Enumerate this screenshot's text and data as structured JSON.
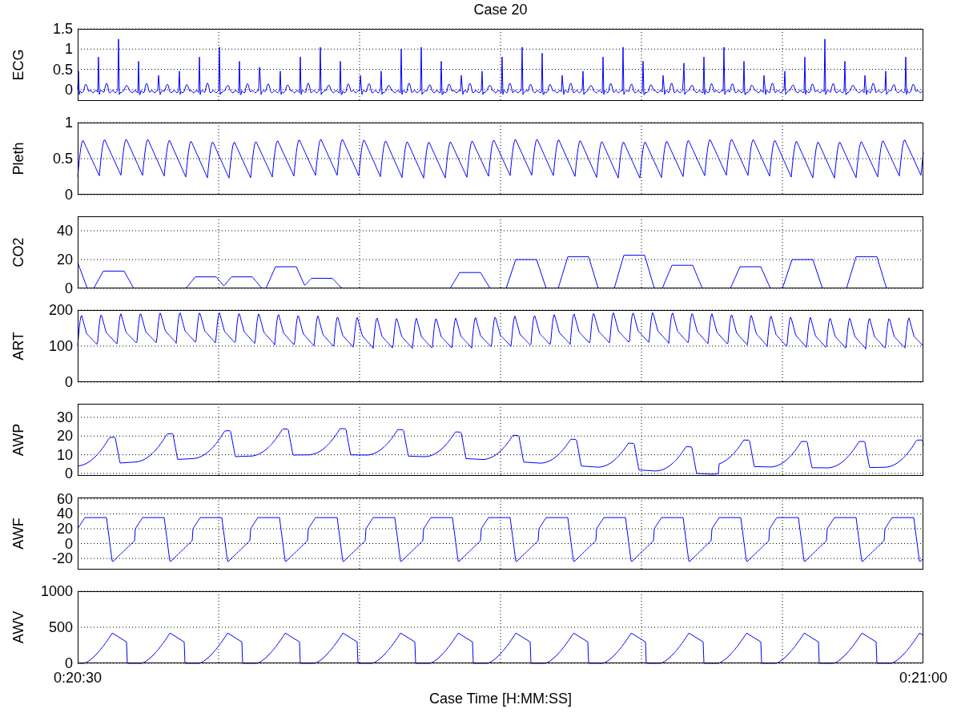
{
  "title": "Case 20",
  "panels": [
    {
      "kind": "ecg",
      "ylabel": "ECG",
      "yticks": [
        "1.5",
        "1",
        "0.5",
        "0"
      ]
    },
    {
      "kind": "pleth",
      "ylabel": "Pleth",
      "yticks": [
        "1",
        "0.5",
        "0"
      ]
    },
    {
      "kind": "co2",
      "ylabel": "CO2",
      "yticks": [
        "40",
        "20",
        "0"
      ]
    },
    {
      "kind": "art",
      "ylabel": "ART",
      "yticks": [
        "200",
        "100",
        "0"
      ]
    },
    {
      "kind": "awp",
      "ylabel": "AWP",
      "yticks": [
        "30",
        "20",
        "10",
        "0"
      ]
    },
    {
      "kind": "awf",
      "ylabel": "AWF",
      "yticks": [
        "60",
        "40",
        "20",
        "0",
        "-20"
      ]
    },
    {
      "kind": "awv",
      "ylabel": "AWV",
      "yticks": [
        "1000",
        "500",
        "0"
      ]
    }
  ],
  "xticks": [
    "0:20:30",
    "0:21:00"
  ],
  "xlabel": "Case Time [H:MM:SS]"
}
